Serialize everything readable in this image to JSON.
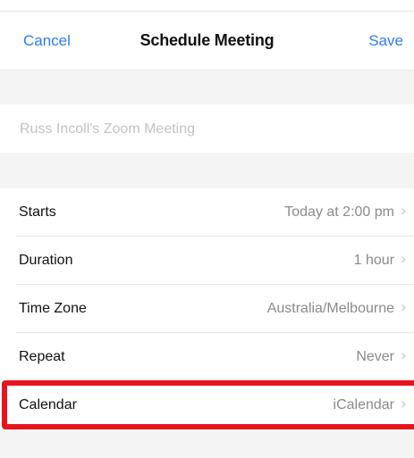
{
  "nav": {
    "cancel_label": "Cancel",
    "title": "Schedule Meeting",
    "save_label": "Save"
  },
  "topic": {
    "placeholder": "Russ Incoll's Zoom Meeting",
    "value": ""
  },
  "rows": [
    {
      "label": "Starts",
      "value": "Today at 2:00 pm"
    },
    {
      "label": "Duration",
      "value": "1 hour"
    },
    {
      "label": "Time Zone",
      "value": "Australia/Melbourne"
    },
    {
      "label": "Repeat",
      "value": "Never"
    },
    {
      "label": "Calendar",
      "value": "iCalendar"
    }
  ],
  "chevron": "›",
  "colors": {
    "accent": "#2f7cf6",
    "highlight": "#e8141c",
    "group_background": "#f4f4f4"
  }
}
